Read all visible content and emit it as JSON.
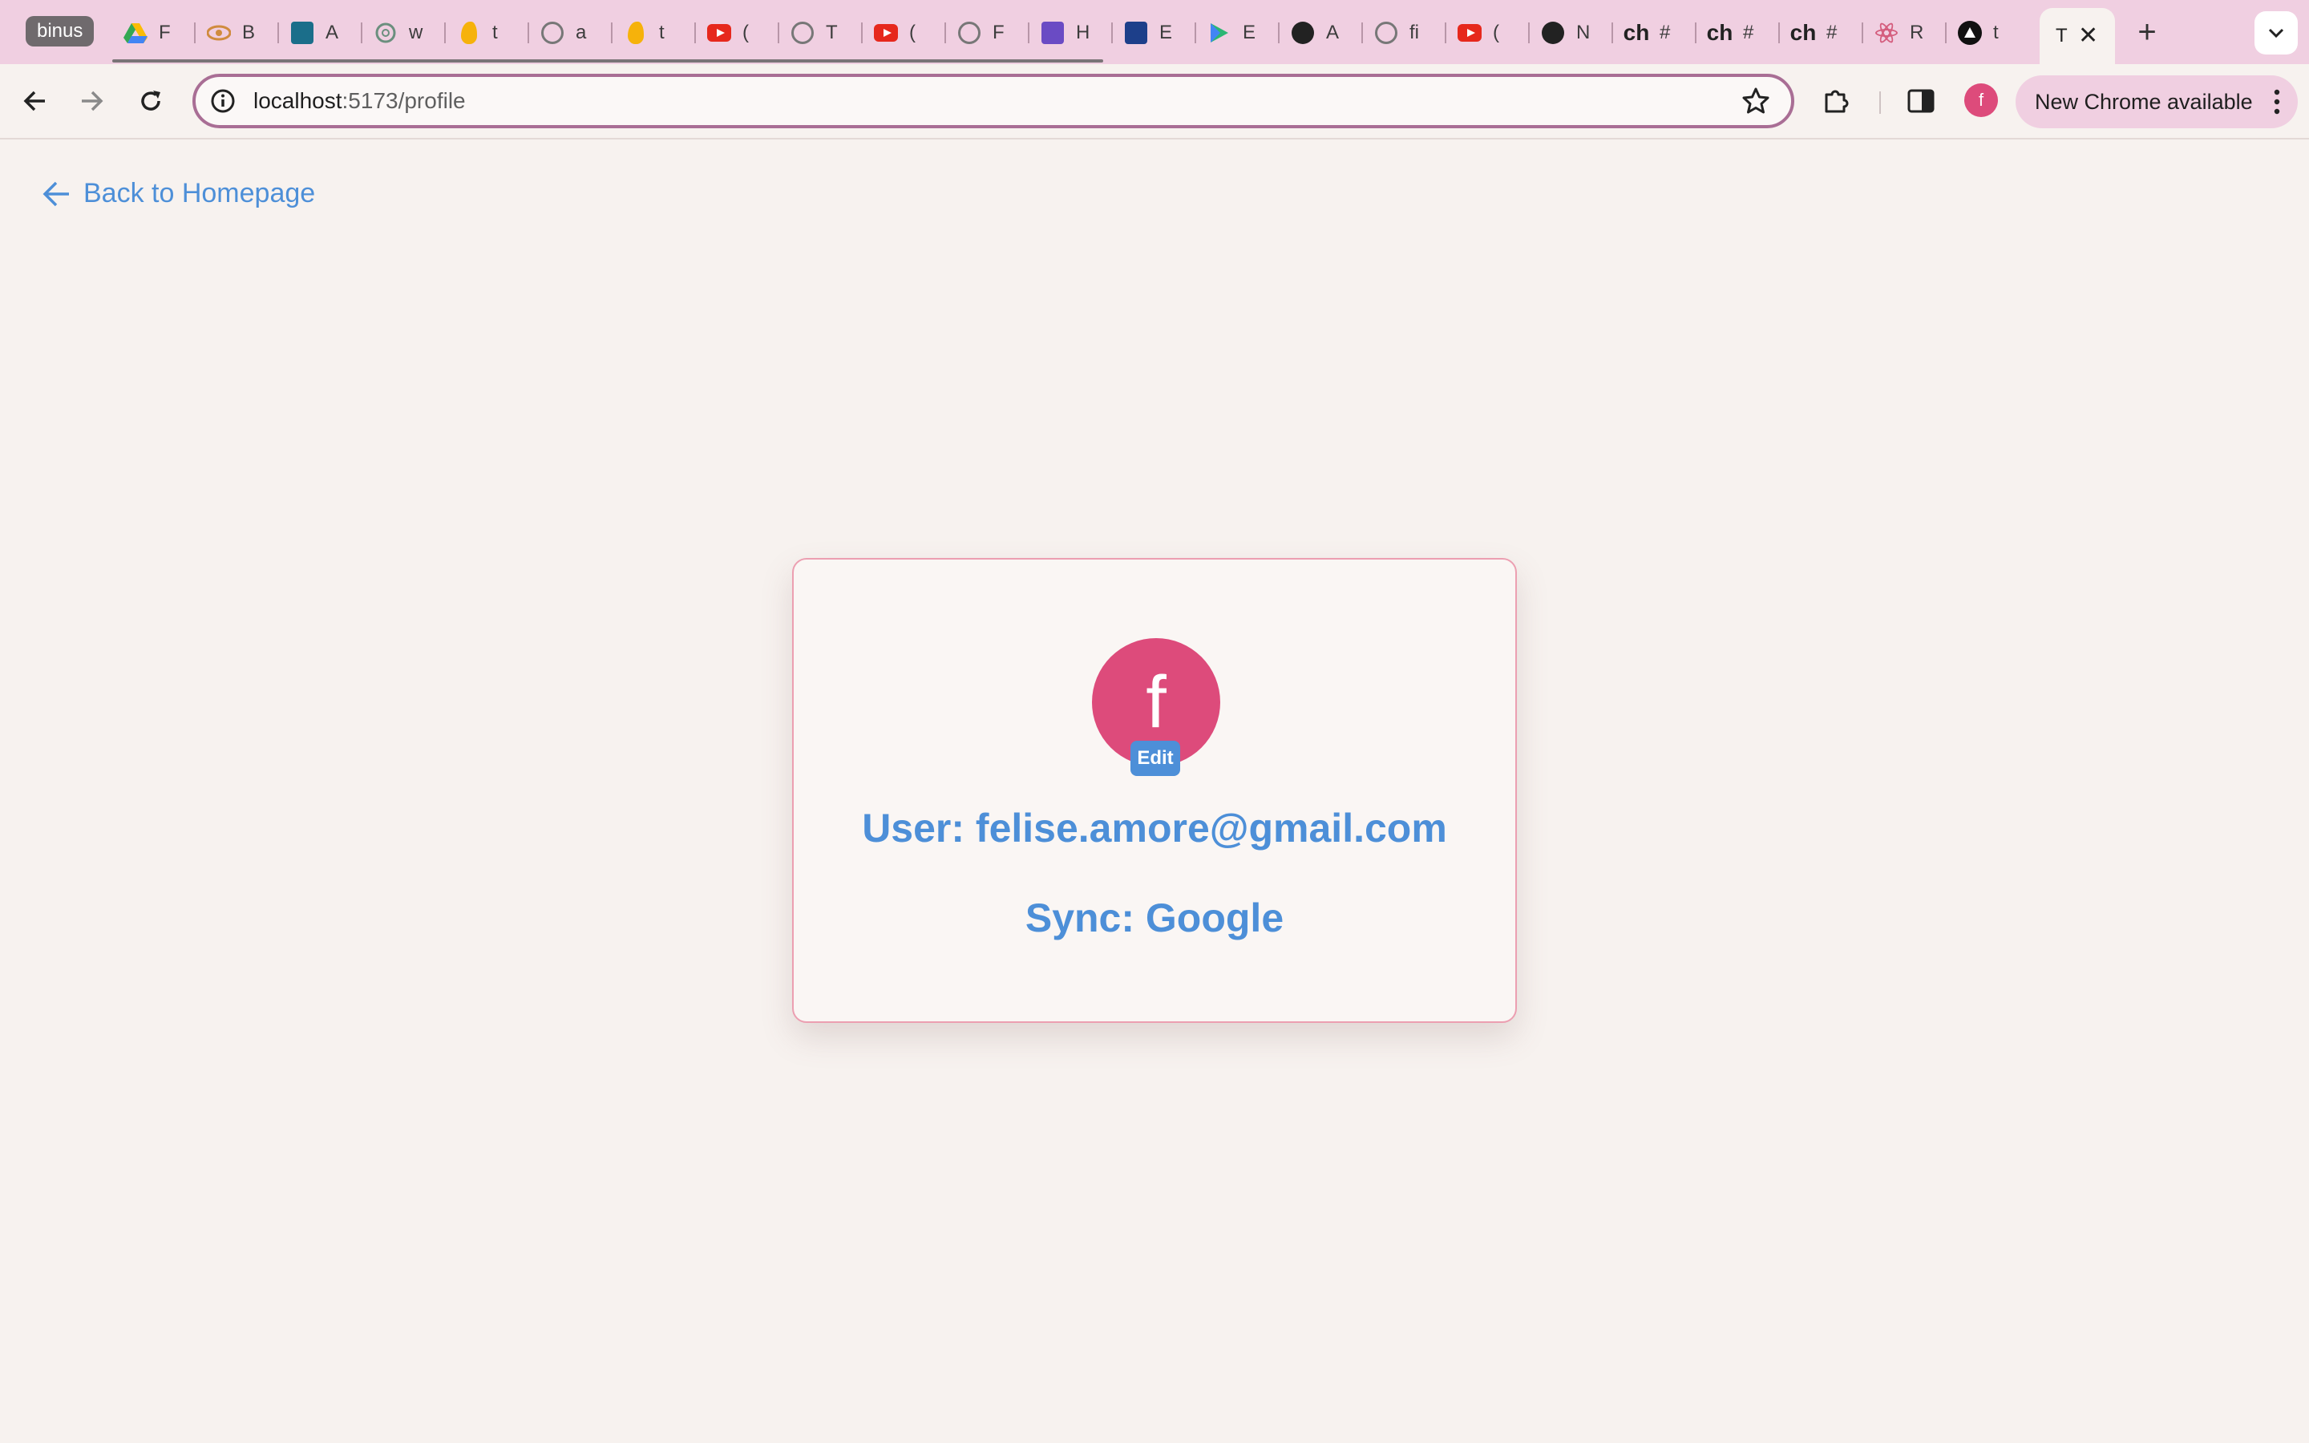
{
  "browser": {
    "tab_group_label": "binus",
    "tabs": [
      {
        "icon": "google-drive-icon",
        "title": "F"
      },
      {
        "icon": "eye-icon",
        "title": "B"
      },
      {
        "icon": "forms-icon",
        "title": "A"
      },
      {
        "icon": "chatgpt-icon",
        "title": "w"
      },
      {
        "icon": "firebase-icon",
        "title": "t"
      },
      {
        "icon": "github-icon",
        "title": "a"
      },
      {
        "icon": "firebase-icon",
        "title": "t"
      },
      {
        "icon": "youtube-icon",
        "title": "("
      },
      {
        "icon": "github-icon",
        "title": "T"
      },
      {
        "icon": "youtube-icon",
        "title": "("
      },
      {
        "icon": "github-icon",
        "title": "F"
      },
      {
        "icon": "app-icon",
        "title": "H"
      },
      {
        "icon": "mdl-icon",
        "title": "E"
      },
      {
        "icon": "play-icon",
        "title": "E"
      },
      {
        "icon": "github-icon",
        "title": "A"
      },
      {
        "icon": "github-icon",
        "title": "fi"
      },
      {
        "icon": "youtube-icon",
        "title": "("
      },
      {
        "icon": "github-icon",
        "title": "N"
      },
      {
        "icon": "ch-icon",
        "title": "#"
      },
      {
        "icon": "ch-icon",
        "title": "#"
      },
      {
        "icon": "ch-icon",
        "title": "#"
      },
      {
        "icon": "react-icon",
        "title": "R"
      },
      {
        "icon": "triangle-icon",
        "title": "t"
      }
    ],
    "active_tab_title": "T",
    "url_host": "localhost",
    "url_path": ":5173/profile",
    "profile_initial": "f",
    "update_label": "New Chrome available"
  },
  "page": {
    "back_link": "Back to Homepage",
    "avatar_initial": "f",
    "edit_label": "Edit",
    "user_line": "User: felise.amore@gmail.com",
    "sync_line": "Sync: Google"
  },
  "colors": {
    "accent_blue": "#4d8fd8",
    "avatar_pink": "#dd4b7b",
    "card_border": "#ec9fb1",
    "page_bg": "#f7f2ef",
    "tabstrip_bg": "#f0cfe1"
  }
}
